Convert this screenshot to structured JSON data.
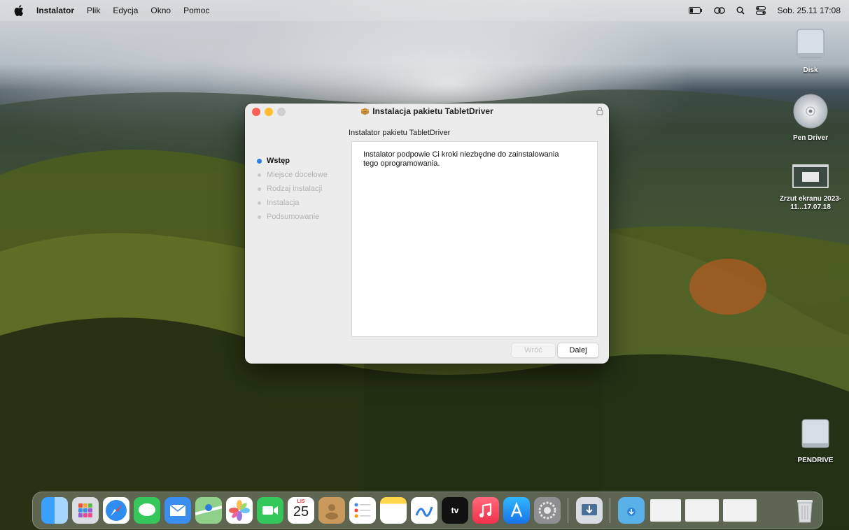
{
  "menubar": {
    "app_name": "Instalator",
    "menus": [
      "Plik",
      "Edycja",
      "Okno",
      "Pomoc"
    ],
    "clock": "Sob. 25.11  17:08",
    "status_icons": [
      "battery-icon",
      "link-icon",
      "search-icon",
      "control-center-icon"
    ]
  },
  "window": {
    "title": "Instalacja pakietu TabletDriver",
    "subtitle": "Instalator pakietu TabletDriver",
    "steps": [
      {
        "label": "Wstęp",
        "active": true
      },
      {
        "label": "Miejsce docelowe",
        "active": false
      },
      {
        "label": "Rodzaj instalacji",
        "active": false
      },
      {
        "label": "Instalacja",
        "active": false
      },
      {
        "label": "Podsumowanie",
        "active": false
      }
    ],
    "body_text": "Instalator podpowie Ci kroki niezbędne do zainstalowania tego oprogramowania.",
    "back_button": "Wróć",
    "next_button": "Dalej"
  },
  "desktop": {
    "icons": [
      {
        "label": "Disk"
      },
      {
        "label": "Pen Driver"
      },
      {
        "label": "Zrzut ekranu 2023-11...17.07.18"
      },
      {
        "label": "PENDRIVE"
      }
    ]
  },
  "dock": {
    "calendar_month": "LIS",
    "calendar_day": "25",
    "tv_label": "tv",
    "apps": [
      "finder-icon",
      "launchpad-icon",
      "safari-icon",
      "messages-icon",
      "mail-icon",
      "maps-icon",
      "photos-icon",
      "facetime-icon",
      "calendar-icon",
      "contacts-icon",
      "reminders-icon",
      "notes-icon",
      "freeform-icon",
      "tv-icon",
      "music-icon",
      "app-store-icon",
      "system-settings-icon",
      "installer-icon",
      "downloads-icon",
      "screenshot-icon",
      "screenshot-icon",
      "screenshot-icon",
      "trash-icon"
    ]
  }
}
